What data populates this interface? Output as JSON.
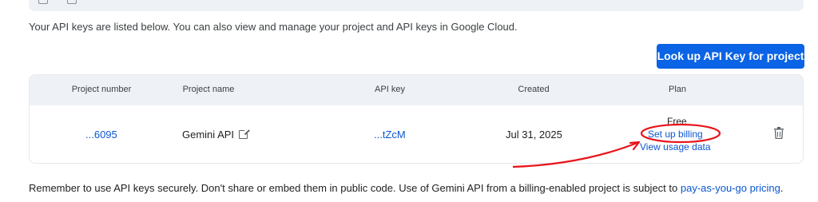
{
  "intro_text": "Your API keys are listed below. You can also view and manage your project and API keys in Google Cloud.",
  "lookup_button": "Look up API Key for project",
  "table": {
    "headers": {
      "project_number": "Project number",
      "project_name": "Project name",
      "api_key": "API key",
      "created": "Created",
      "plan": "Plan"
    },
    "row": {
      "project_number": "...6095",
      "project_name": "Gemini API",
      "api_key": "...tZcM",
      "created": "Jul 31, 2025",
      "plan": "Free",
      "setup_billing": "Set up billing",
      "view_usage": "View usage data"
    }
  },
  "footer": {
    "text": "Remember to use API keys securely. Don't share or embed them in public code. Use of Gemini API from a billing-enabled project is subject to ",
    "link": "pay-as-you-go pricing",
    "suffix": "."
  },
  "icons": {
    "project_name_link": "external-link-icon",
    "row_action": "trash-icon"
  },
  "colors": {
    "accent": "#0b63e5",
    "link": "#0b57d0",
    "header_bg": "#eef1f6",
    "annotation": "#e8141b"
  }
}
